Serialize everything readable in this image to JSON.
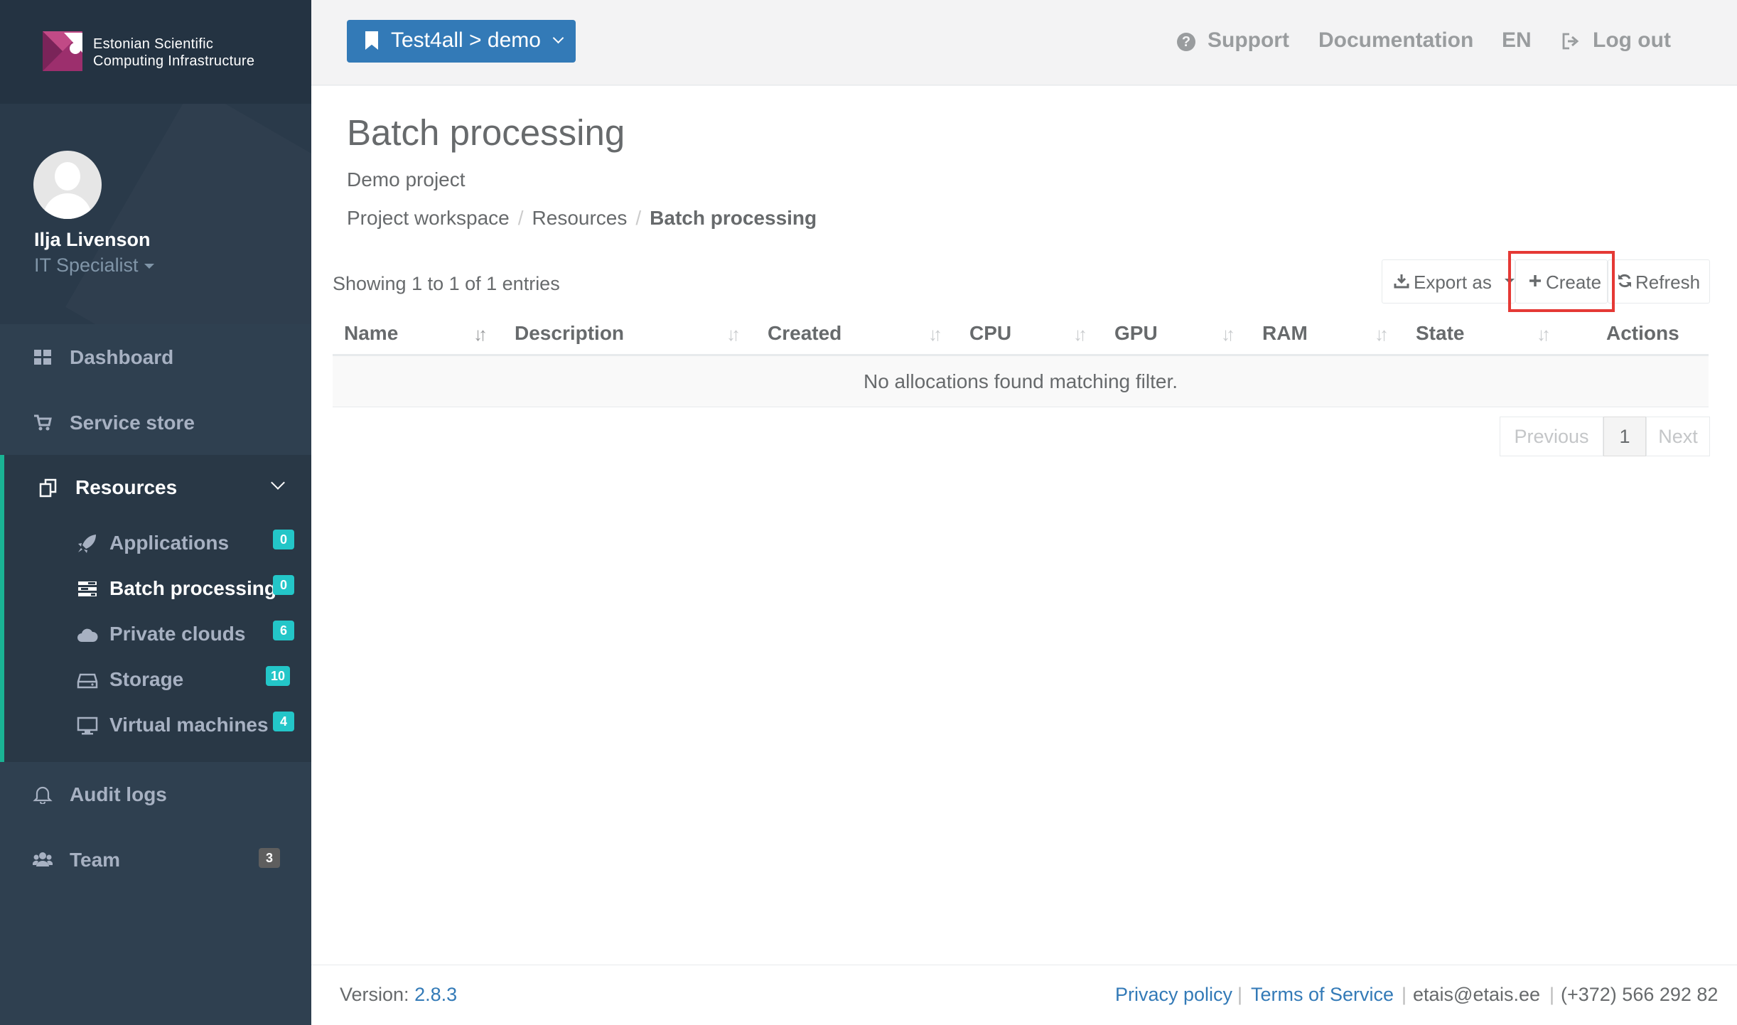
{
  "brand": {
    "line1": "Estonian Scientific",
    "line2": "Computing Infrastructure"
  },
  "user": {
    "name": "Ilja Livenson",
    "role": "IT Specialist"
  },
  "nav": {
    "dashboard": "Dashboard",
    "service_store": "Service store",
    "resources": "Resources",
    "audit_logs": "Audit logs",
    "team": "Team",
    "team_count": "3"
  },
  "resources": [
    {
      "label": "Applications",
      "count": "0"
    },
    {
      "label": "Batch processing",
      "count": "0"
    },
    {
      "label": "Private clouds",
      "count": "6"
    },
    {
      "label": "Storage",
      "count": "10"
    },
    {
      "label": "Virtual machines",
      "count": "4"
    }
  ],
  "topbar": {
    "project_selector": "Test4all > demo",
    "support": "Support",
    "documentation": "Documentation",
    "language": "EN",
    "logout": "Log out"
  },
  "page": {
    "title": "Batch processing",
    "subtitle": "Demo project",
    "breadcrumb": [
      "Project workspace",
      "Resources",
      "Batch processing"
    ]
  },
  "table": {
    "info": "Showing 1 to 1 of 1 entries",
    "export_label": "Export as",
    "create_label": "Create",
    "refresh_label": "Refresh",
    "columns": [
      "Name",
      "Description",
      "Created",
      "CPU",
      "GPU",
      "RAM",
      "State",
      "Actions"
    ],
    "sort_glyph": "↓↑",
    "empty_message": "No allocations found matching filter.",
    "pagination": {
      "previous": "Previous",
      "current": "1",
      "next": "Next"
    }
  },
  "footer": {
    "version_label": "Version:",
    "version": "2.8.3",
    "privacy": "Privacy policy",
    "terms": "Terms of Service",
    "email": "etais@etais.ee",
    "phone": "(+372) 566 292 82",
    "separator": "|"
  },
  "colors": {
    "sidebar": "#2f4050",
    "accent": "#1ab394",
    "badge": "#23c6c8",
    "primary_button": "#337ab7",
    "highlight": "#e53935"
  }
}
